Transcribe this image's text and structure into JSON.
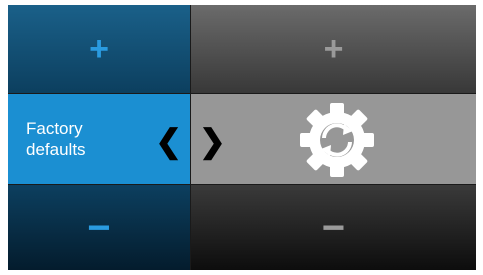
{
  "left": {
    "top_sign": "+",
    "label_line1": "Factory",
    "label_line2": "defaults",
    "bottom_sign": "−",
    "prev_chevron": "❮"
  },
  "right": {
    "top_sign": "+",
    "bottom_sign": "−",
    "next_chevron": "❯",
    "value_icon": "factory-reset-gear-icon"
  },
  "colors": {
    "selected_blue": "#1b8fd2",
    "dark_blue": "#0c3f5f",
    "grey_selected": "#979797",
    "accent_sign_blue": "#2a9be0"
  }
}
